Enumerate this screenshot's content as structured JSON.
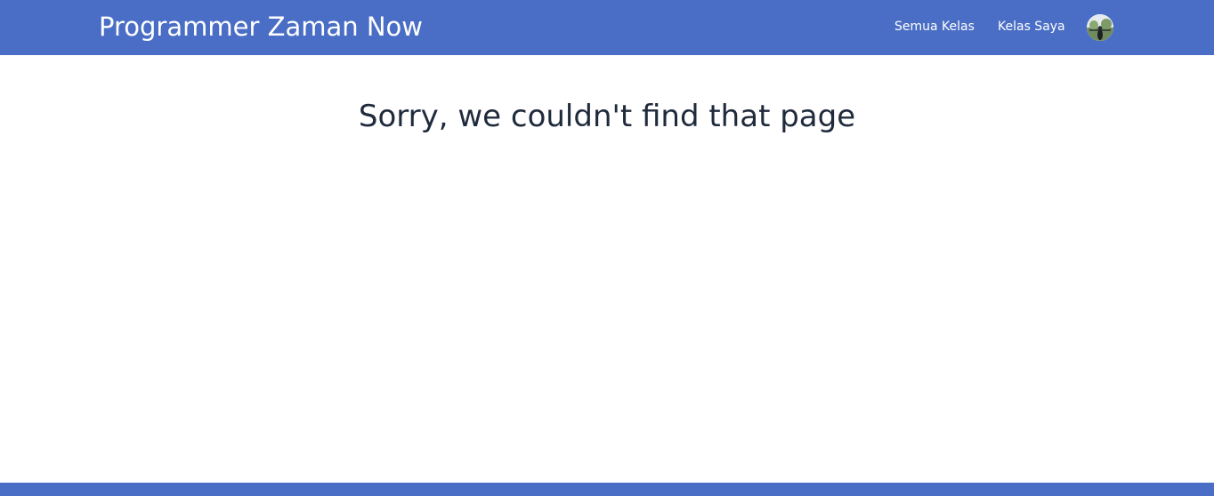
{
  "header": {
    "brand": "Programmer Zaman Now",
    "nav": [
      {
        "label": "Semua Kelas"
      },
      {
        "label": "Kelas Saya"
      }
    ],
    "avatar_icon": "user-avatar-icon"
  },
  "main": {
    "title": "Sorry, we couldn't find that page"
  },
  "colors": {
    "brand": "#4a6ec5",
    "text": "#1f2a3c",
    "background": "#ffffff"
  }
}
